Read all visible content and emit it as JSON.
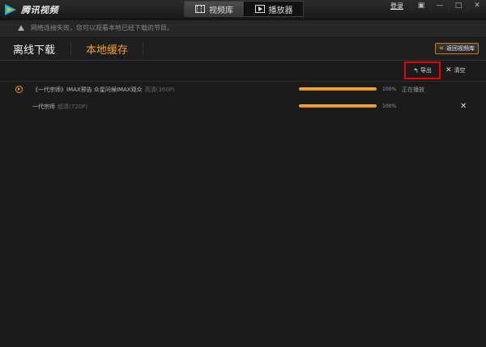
{
  "app": {
    "logo_text": "腾讯视频"
  },
  "topnav": {
    "tabs": [
      {
        "label": "视频库",
        "icon": "film-icon",
        "active": true
      },
      {
        "label": "播放器",
        "icon": "play-icon",
        "active": false
      }
    ]
  },
  "window": {
    "login_label": "登录",
    "skin_glyph": "▣",
    "minimize_glyph": "—",
    "maximize_glyph": "□",
    "close_glyph": "✕"
  },
  "notice": {
    "text": "网络连接失败，您可以观看本地已经下载的节目。"
  },
  "subheader": {
    "tab_offline": "离线下载",
    "tab_local": "本地缓存",
    "back_label": "返回视频库"
  },
  "toolbar": {
    "export_label": "导出",
    "clear_label": "清空"
  },
  "rows": [
    {
      "title": "《一代宗师》IMAX预告 众星问候IMAX观众",
      "quality": "高清(360P)",
      "progress": 100,
      "pct_label": "100%",
      "status": "正在播放"
    },
    {
      "title": "一代宗师",
      "quality": "超清(720P)",
      "progress": 100,
      "pct_label": "100%",
      "status": ""
    }
  ],
  "colors": {
    "accent": "#f4a21e",
    "highlight_box": "#e00000",
    "background": "#1b1b1b"
  }
}
